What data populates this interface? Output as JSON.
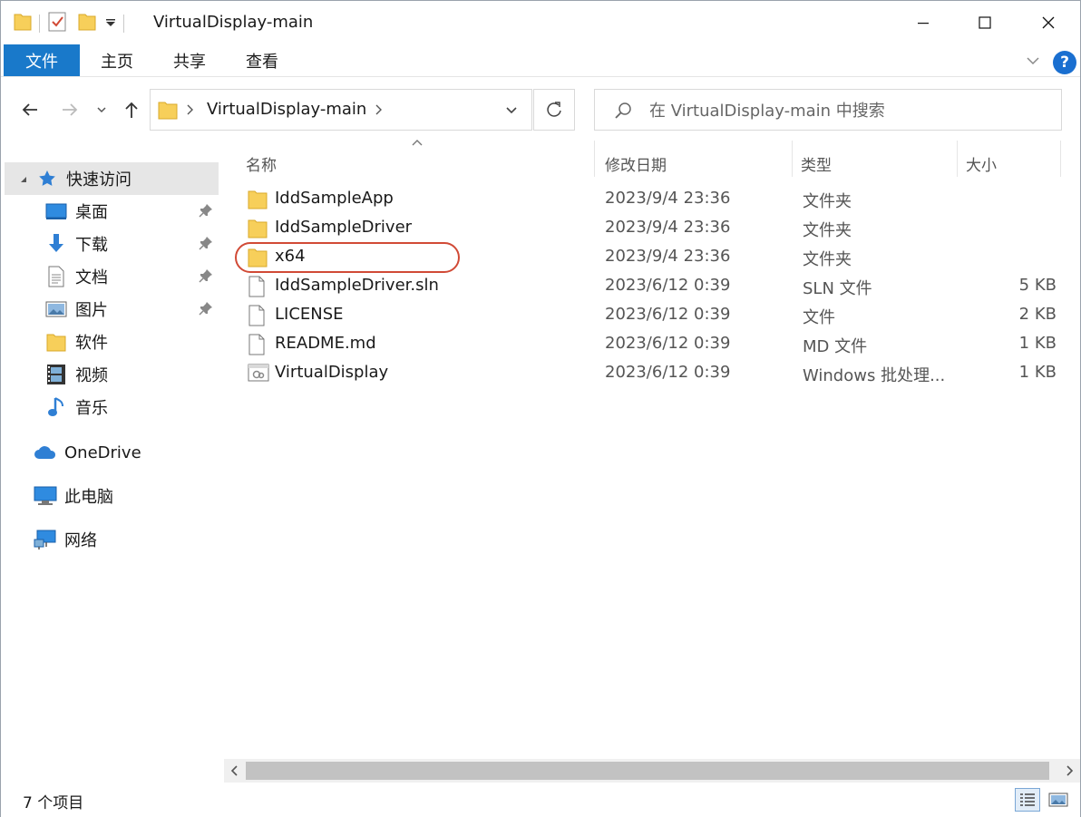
{
  "window": {
    "title": "VirtualDisplay-main",
    "minimize_icon": "minimize-icon",
    "maximize_icon": "maximize-icon",
    "close_icon": "close-icon"
  },
  "ribbon": {
    "tabs": [
      "文件",
      "主页",
      "共享",
      "查看"
    ],
    "help_label": "?"
  },
  "address": {
    "path": "VirtualDisplay-main",
    "search_placeholder": "在 VirtualDisplay-main 中搜索"
  },
  "sidebar": {
    "quick_access": "快速访问",
    "pinned": [
      {
        "label": "桌面",
        "icon": "desktop-icon",
        "pinned": true
      },
      {
        "label": "下载",
        "icon": "download-icon",
        "pinned": true
      },
      {
        "label": "文档",
        "icon": "document-icon",
        "pinned": true
      },
      {
        "label": "图片",
        "icon": "pictures-icon",
        "pinned": true
      },
      {
        "label": "软件",
        "icon": "folder-icon",
        "pinned": false
      },
      {
        "label": "视频",
        "icon": "video-icon",
        "pinned": false
      },
      {
        "label": "音乐",
        "icon": "music-icon",
        "pinned": false
      }
    ],
    "onedrive": "OneDrive",
    "this_pc": "此电脑",
    "network": "网络"
  },
  "columns": {
    "name": "名称",
    "date": "修改日期",
    "type": "类型",
    "size": "大小"
  },
  "files": [
    {
      "name": "IddSampleApp",
      "date": "2023/9/4 23:36",
      "type": "文件夹",
      "size": "",
      "kind": "folder"
    },
    {
      "name": "IddSampleDriver",
      "date": "2023/9/4 23:36",
      "type": "文件夹",
      "size": "",
      "kind": "folder"
    },
    {
      "name": "x64",
      "date": "2023/9/4 23:36",
      "type": "文件夹",
      "size": "",
      "kind": "folder"
    },
    {
      "name": "IddSampleDriver.sln",
      "date": "2023/6/12 0:39",
      "type": "SLN 文件",
      "size": "5 KB",
      "kind": "file"
    },
    {
      "name": "LICENSE",
      "date": "2023/6/12 0:39",
      "type": "文件",
      "size": "2 KB",
      "kind": "file"
    },
    {
      "name": "README.md",
      "date": "2023/6/12 0:39",
      "type": "MD 文件",
      "size": "1 KB",
      "kind": "file"
    },
    {
      "name": "VirtualDisplay",
      "date": "2023/6/12 0:39",
      "type": "Windows 批处理...",
      "size": "1 KB",
      "kind": "batch"
    }
  ],
  "status": {
    "item_count": "7 个项目"
  },
  "colors": {
    "file_tab": "#1979ca",
    "folder": "#f7cf5a",
    "highlight": "#d14a36"
  }
}
